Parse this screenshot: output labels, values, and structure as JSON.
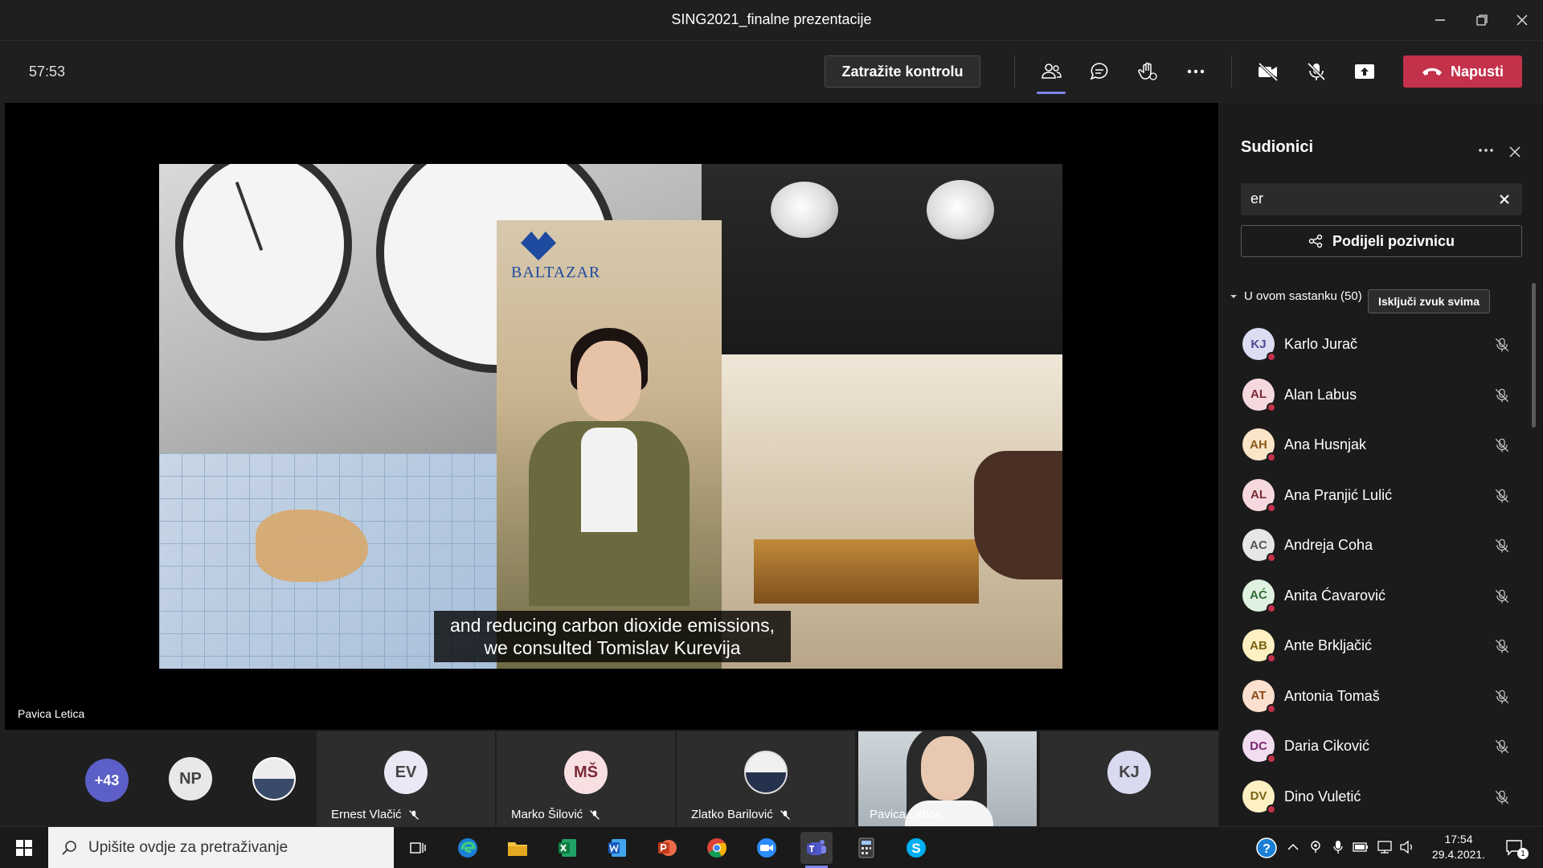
{
  "window": {
    "title": "SING2021_finalne prezentacije"
  },
  "toolbar": {
    "timer": "57:53",
    "request_control_label": "Zatražite kontrolu",
    "leave_label": "Napusti",
    "leave_color": "#c4314b",
    "icons": [
      "participants-icon",
      "chat-icon",
      "raise-hand-icon",
      "more-icon",
      "camera-off-icon",
      "mic-off-icon",
      "share-icon"
    ]
  },
  "stage": {
    "speaker_name": "Pavica Letica",
    "logo_text": "BALTAZAR",
    "subtitle_line1": "and reducing carbon dioxide emissions,",
    "subtitle_line2": "we consulted Tomislav Kurevija"
  },
  "gallery": {
    "overflow_count": "+43",
    "avatars": [
      {
        "initials": "NP",
        "bg": "#e8e8e8",
        "fg": "#444"
      }
    ],
    "tiles": [
      {
        "initials": "EV",
        "name": "Ernest Vlačić",
        "bg": "#e9e9f5",
        "fg": "#444"
      },
      {
        "initials": "MŠ",
        "name": "Marko Šilović",
        "bg": "#f7dfe2",
        "fg": "#7a2a35"
      },
      {
        "initials": "",
        "name": "Zlatko Barilović"
      },
      {
        "initials": "",
        "name": "Pavica Letica"
      },
      {
        "initials": "KJ",
        "name": "",
        "bg": "#d9d9f0",
        "fg": "#444"
      }
    ]
  },
  "panel": {
    "title": "Sudionici",
    "search_value": "er",
    "invite_label": "Podijeli pozivnicu",
    "section_label": "U ovom sastanku (50)",
    "mute_all_label": "Isključi zvuk svima",
    "participants": [
      {
        "initials": "KJ",
        "name": "Karlo Jurač",
        "bg": "#dcdcf2",
        "fg": "#4b4b8f"
      },
      {
        "initials": "AL",
        "name": "Alan Labus",
        "bg": "#f5d9de",
        "fg": "#7a2a35"
      },
      {
        "initials": "AH",
        "name": "Ana Husnjak",
        "bg": "#fbe5c8",
        "fg": "#8a5a1a"
      },
      {
        "initials": "AL",
        "name": "Ana Pranjić Lulić",
        "bg": "#f5d9de",
        "fg": "#7a2a35"
      },
      {
        "initials": "AC",
        "name": "Andreja Coha",
        "bg": "#e6e6e6",
        "fg": "#555"
      },
      {
        "initials": "AĆ",
        "name": "Anita Ćavarović",
        "bg": "#dff1e0",
        "fg": "#2f6b34"
      },
      {
        "initials": "AB",
        "name": "Ante Brkljačić",
        "bg": "#fdf0c2",
        "fg": "#7a6214"
      },
      {
        "initials": "AT",
        "name": "Antonia Tomaš",
        "bg": "#fbe0cf",
        "fg": "#8a4a1a"
      },
      {
        "initials": "DC",
        "name": "Daria Ciković",
        "bg": "#f2dcf0",
        "fg": "#7a2a70"
      },
      {
        "initials": "DV",
        "name": "Dino Vuletić",
        "bg": "#fdf0c2",
        "fg": "#7a6214"
      }
    ]
  },
  "taskbar": {
    "search_placeholder": "Upišite ovdje za pretraživanje",
    "time": "17:54",
    "date": "29.4.2021.",
    "notifications": "1",
    "apps": [
      "task-view-icon",
      "edge-icon",
      "file-explorer-icon",
      "excel-icon",
      "word-icon",
      "powerpoint-icon",
      "chrome-icon",
      "zoom-icon",
      "teams-icon",
      "calculator-icon",
      "skype-icon"
    ]
  }
}
